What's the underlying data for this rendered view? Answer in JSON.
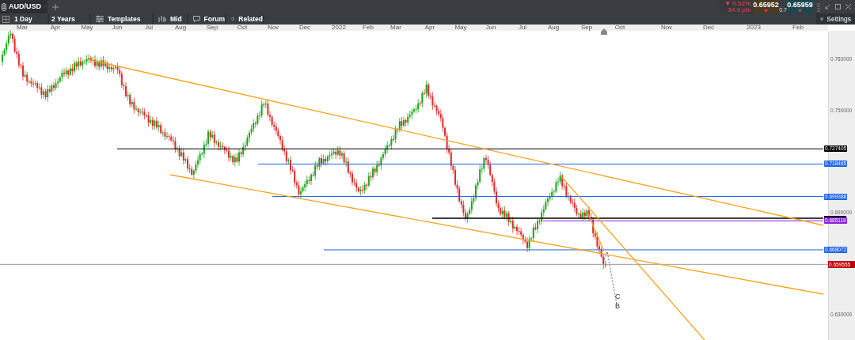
{
  "tab": {
    "number": "1",
    "symbol": "AUD/USD"
  },
  "toolbar": {
    "interval": "1 Day",
    "range": "2 Years",
    "buttons": [
      {
        "kind": "templates",
        "label": "Templates"
      },
      {
        "kind": "mid",
        "label": "Mid"
      },
      {
        "kind": "forum",
        "label": "Forum"
      },
      {
        "kind": "related",
        "label": "Related"
      }
    ],
    "settings": "Settings"
  },
  "quote": {
    "change": "▼ 0.52%",
    "points": "34.9 pts",
    "sell": "0.65952",
    "buy": "0.65959",
    "spread": "0.7"
  },
  "x_axis": [
    "Mar",
    "Apr",
    "May",
    "Jun",
    "Jul",
    "Aug",
    "Sep",
    "Oct",
    "Nov",
    "Dec",
    "2022",
    "Feb",
    "Mar",
    "Apr",
    "May",
    "Jun",
    "Jul",
    "Aug",
    "Sep",
    "Oct",
    "Nov",
    "Dec",
    "2023",
    "Feb"
  ],
  "y_axis": [
    "0.780000",
    "0.750000",
    "0.690000",
    "0.630000"
  ],
  "price_lines": [
    {
      "kind": "labeled",
      "label": "0.727405",
      "color": "#000000"
    },
    {
      "kind": "labeled",
      "label": "0.718465",
      "color": "#1e63e6"
    },
    {
      "kind": "labeled",
      "label": "0.699388",
      "color": "#1e63e6"
    },
    {
      "kind": "unlabeled",
      "color": "#000000"
    },
    {
      "kind": "labeled",
      "label": "0.685119",
      "color": "#8a1fe0"
    },
    {
      "kind": "labeled",
      "label": "0.668072",
      "color": "#1e63e6"
    },
    {
      "kind": "current",
      "label": "0.659555",
      "color": "#c00000"
    }
  ],
  "annotations": [
    "C",
    "B"
  ]
}
